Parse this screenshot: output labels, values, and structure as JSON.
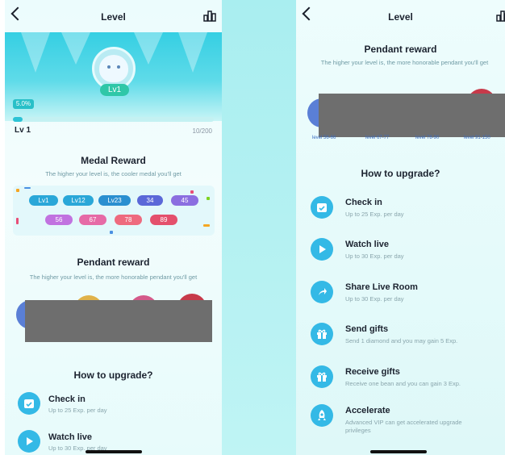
{
  "left": {
    "header": {
      "title": "Level"
    },
    "progress": {
      "percent_label": "5.0%",
      "level_label": "Lv 1",
      "exp_label": "10/200",
      "fraction": 0.05
    },
    "avatar_badge": "Lv1",
    "medal": {
      "title": "Medal Reward",
      "subtitle": "The higher your level is, the cooler medal you'll get",
      "badges": [
        {
          "label": "Lv1",
          "color": "#2aa7d8"
        },
        {
          "label": "Lv12",
          "color": "#2aa7d8"
        },
        {
          "label": "Lv23",
          "color": "#2a8fd0"
        },
        {
          "label": "34",
          "color": "#5b68d8"
        },
        {
          "label": "45",
          "color": "#8b6ee0"
        },
        {
          "label": "56",
          "color": "#c172e0"
        },
        {
          "label": "67",
          "color": "#e66aa6"
        },
        {
          "label": "78",
          "color": "#ee6a7e"
        },
        {
          "label": "89",
          "color": "#e4506c"
        }
      ]
    },
    "pendant": {
      "title": "Pendant reward",
      "subtitle": "The higher your level is, the more honorable pendant you'll get"
    },
    "upgrade": {
      "title": "How to upgrade?",
      "items": [
        {
          "title": "Check in",
          "desc": "Up to 25 Exp. per day"
        },
        {
          "title": "Watch live",
          "desc": "Up to 30 Exp. per day"
        }
      ]
    }
  },
  "right": {
    "header": {
      "title": "Level"
    },
    "pendant": {
      "title": "Pendant reward",
      "subtitle": "The higher your level is, the more honorable pendant you'll get",
      "captions": [
        "level 56-66",
        "level 67-77",
        "level 78-90",
        "level 91-150"
      ]
    },
    "upgrade": {
      "title": "How to upgrade?",
      "items": [
        {
          "title": "Check in",
          "desc": "Up to 25 Exp. per day",
          "icon": "calendar-check-icon"
        },
        {
          "title": "Watch live",
          "desc": "Up to 30 Exp. per day",
          "icon": "play-icon"
        },
        {
          "title": "Share Live Room",
          "desc": "Up to 30 Exp. per day",
          "icon": "share-icon"
        },
        {
          "title": "Send gifts",
          "desc": "Send 1 diamond and you may gain 5 Exp.",
          "icon": "gift-icon"
        },
        {
          "title": "Receive gifts",
          "desc": "Receive one bean and you can gain 3 Exp.",
          "icon": "gift-receive-icon"
        },
        {
          "title": "Accelerate",
          "desc": "Advanced VIP can get accelerated upgrade privileges",
          "icon": "rocket-icon"
        }
      ]
    }
  },
  "colors": {
    "accent": "#2cc3d5",
    "icon_blue": "#34b9e6"
  }
}
